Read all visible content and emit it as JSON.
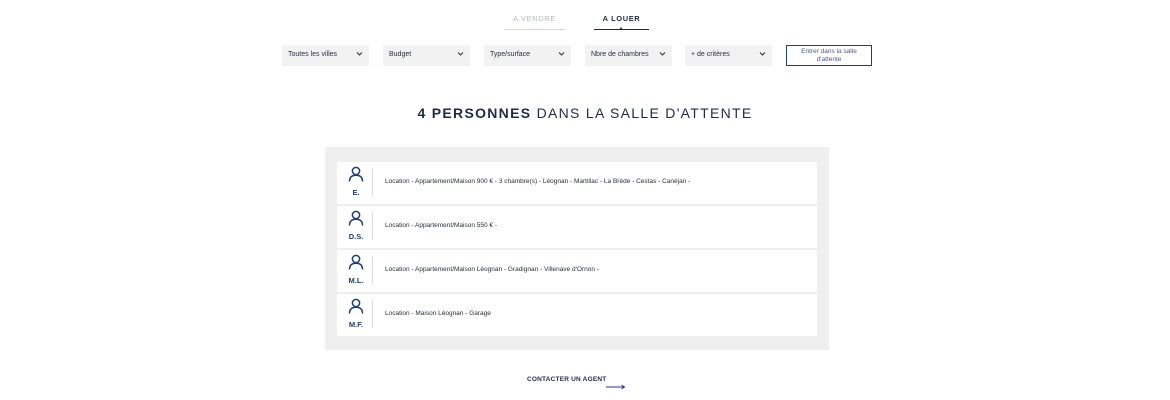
{
  "tabs": [
    {
      "label": "A VENDRE",
      "active": false
    },
    {
      "label": "A LOUER",
      "active": true
    }
  ],
  "filters": {
    "city": "Toutes les villes",
    "budget": "Budget",
    "type": "Type/surface",
    "rooms": "Nbre de chambres",
    "more": "+ de critères",
    "chevron_icon": "chevron-down-icon"
  },
  "wait_button": "Entrer dans la salle d'attente",
  "headline": {
    "count": "4 personnes",
    "rest": "dans la salle d'attente"
  },
  "people": [
    {
      "initials": "E.",
      "text": "Location - Appartement/Maison 900 € - 3 chambre(s) - Léognan - Martillac - La Brède - Cestas - Canéjan -"
    },
    {
      "initials": "D.S.",
      "text": "Location - Appartement/Maison 550 € -"
    },
    {
      "initials": "M.L.",
      "text": "Location - Appartement/Maison Léognan - Gradignan - Villenave d'Ornon -"
    },
    {
      "initials": "M.F.",
      "text": "Location - Maison Léognan - Garage"
    }
  ],
  "contact": "CONTACTER UN AGENT",
  "colors": {
    "navy": "#1f2a4a",
    "accent": "#1f3f7a",
    "panel_bg": "#efefef",
    "filter_bg": "#f2f2f2"
  }
}
